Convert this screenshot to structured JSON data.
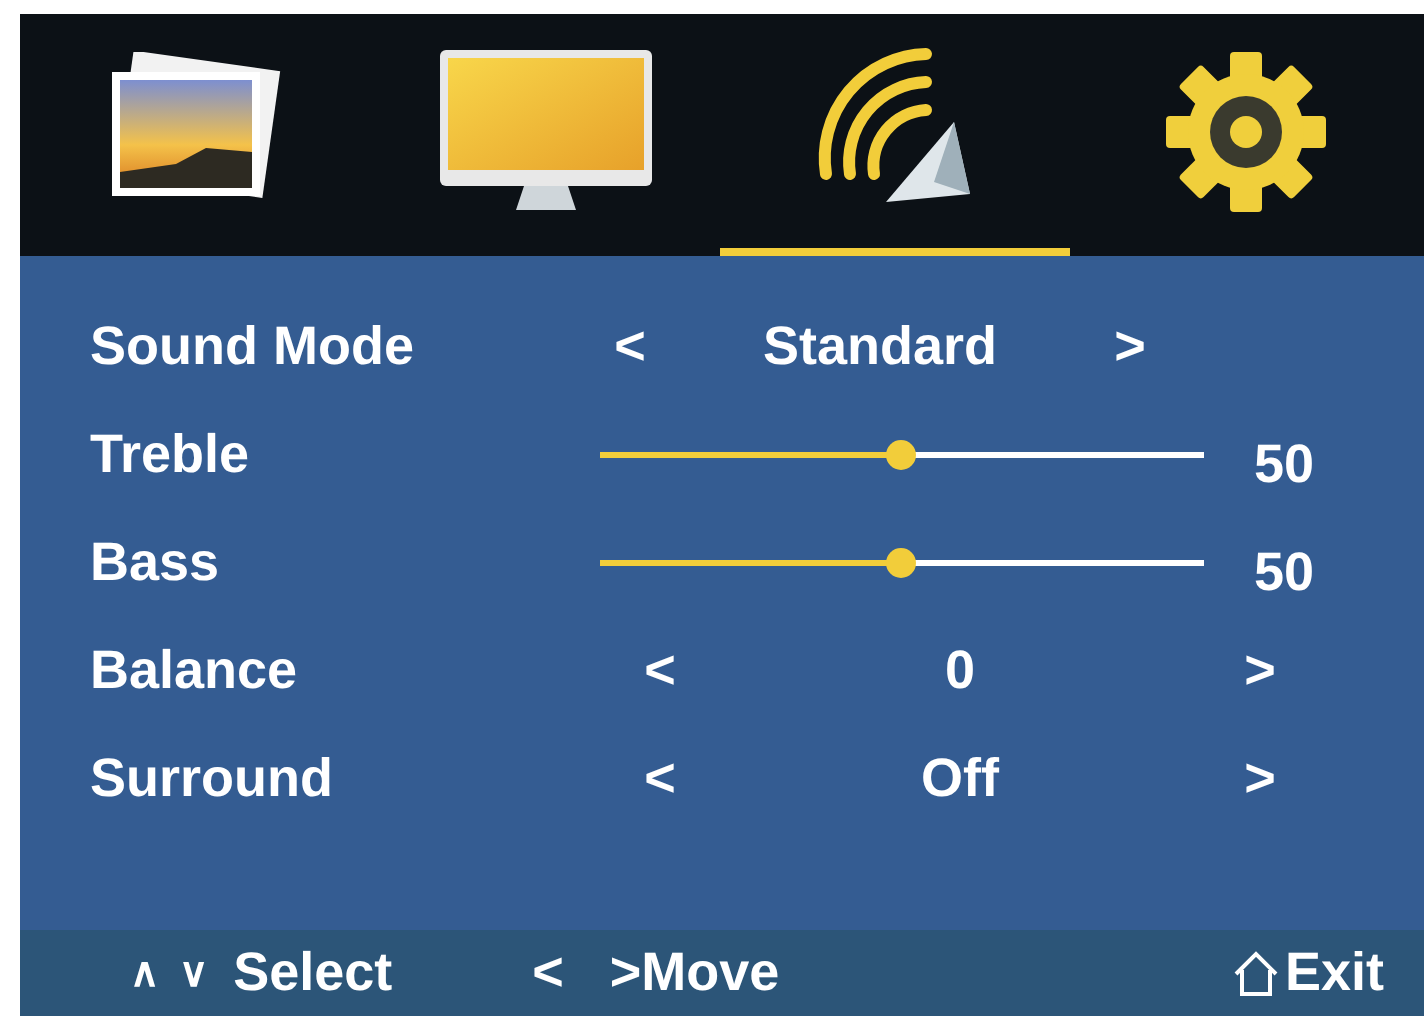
{
  "tabs": [
    {
      "kind": "photos",
      "selected": false
    },
    {
      "kind": "monitor",
      "selected": false
    },
    {
      "kind": "sound",
      "selected": true
    },
    {
      "kind": "settings",
      "selected": false
    }
  ],
  "rows": [
    {
      "kind": "option",
      "label": "Sound  Mode",
      "prev": "<",
      "value": "Standard",
      "next": ">"
    },
    {
      "kind": "slider",
      "label": "Treble",
      "level": 0.5,
      "reading": "50"
    },
    {
      "kind": "slider",
      "label": "Bass",
      "level": 0.5,
      "reading": "50"
    },
    {
      "kind": "option",
      "label": "Balance",
      "prev": "<",
      "value": "0",
      "next": ">"
    },
    {
      "kind": "option",
      "label": "Surround",
      "prev": "<",
      "value": "Off",
      "next": ">"
    }
  ],
  "footer": [
    {
      "kind": "keys",
      "keys": "∧ ∨",
      "label": "Select"
    },
    {
      "kind": "keys",
      "keys": "<  >",
      "label": "Move"
    },
    {
      "kind": "home",
      "label": "Exit"
    }
  ]
}
